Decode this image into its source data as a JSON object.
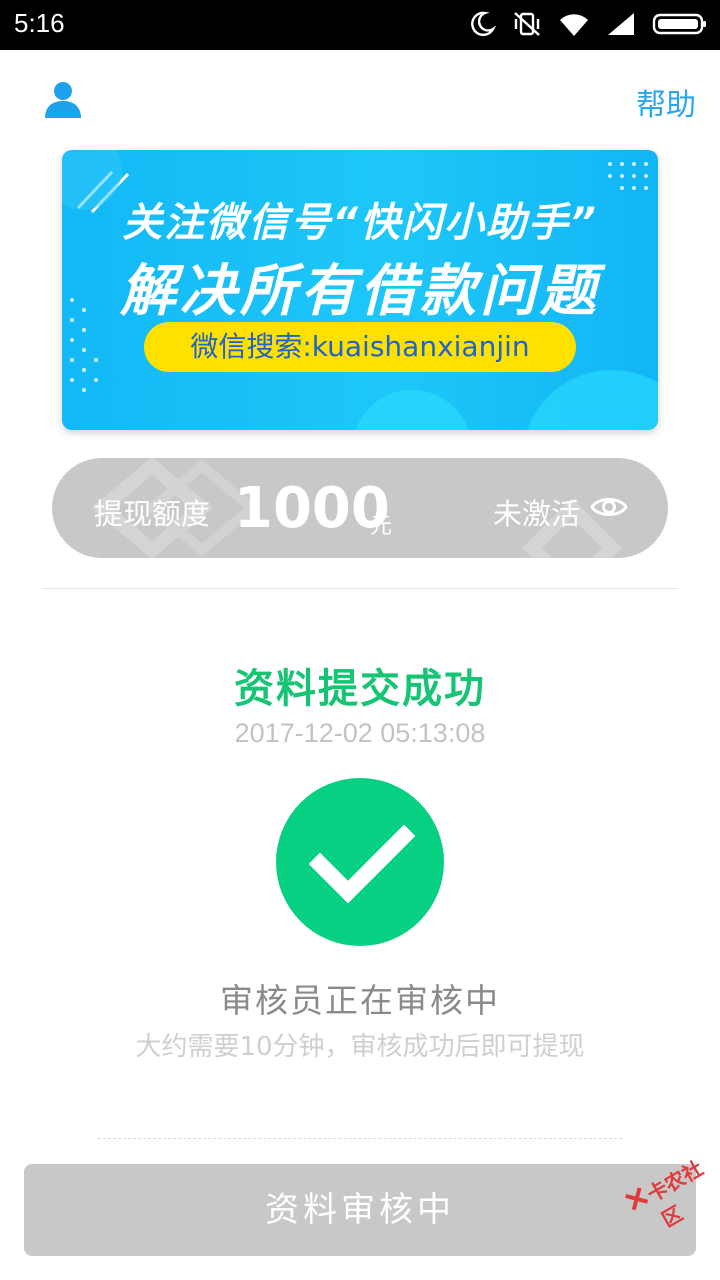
{
  "status_bar": {
    "time": "5:16",
    "icons": [
      "moon-icon",
      "vibrate-off-icon",
      "wifi-icon",
      "signal-icon",
      "battery-icon"
    ]
  },
  "header": {
    "user_icon": "user-icon",
    "help_label": "帮助",
    "accent_color": "#2aa6ee"
  },
  "banner": {
    "line1": "关注微信号“快闪小助手”",
    "line2": "解决所有借款问题",
    "search_text": "微信搜索:kuaishanxianjin"
  },
  "quota": {
    "label": "提现额度",
    "amount": "1000",
    "unit": "元",
    "state": "未激活",
    "eye_icon": "eye-icon"
  },
  "result": {
    "title": "资料提交成功",
    "timestamp": "2017-12-02 05:13:08",
    "success_color": "#08d083",
    "review_title": "审核员正在审核中",
    "review_subtitle": "大约需要10分钟，审核成功后即可提现"
  },
  "bottom_button": {
    "label": "资料审核中"
  },
  "watermark": {
    "text": "卡农社区"
  }
}
